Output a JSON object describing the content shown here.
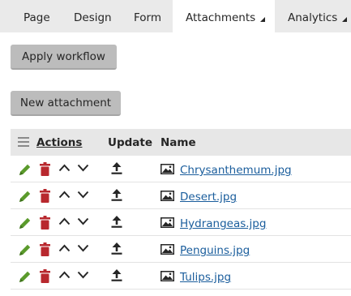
{
  "tabs": [
    {
      "label": "Page",
      "active": false,
      "dropdown": false
    },
    {
      "label": "Design",
      "active": false,
      "dropdown": false
    },
    {
      "label": "Form",
      "active": false,
      "dropdown": false
    },
    {
      "label": "Attachments",
      "active": true,
      "dropdown": true
    },
    {
      "label": "Analytics",
      "active": false,
      "dropdown": true
    }
  ],
  "buttons": {
    "apply_workflow": "Apply workflow",
    "new_attachment": "New attachment"
  },
  "grid": {
    "columns": {
      "actions": "Actions",
      "update": "Update",
      "name": "Name"
    },
    "rows": [
      {
        "name": "Chrysanthemum.jpg"
      },
      {
        "name": "Desert.jpg"
      },
      {
        "name": "Hydrangeas.jpg"
      },
      {
        "name": "Penguins.jpg"
      },
      {
        "name": "Tulips.jpg"
      }
    ]
  },
  "colors": {
    "edit_icon": "#5a9a2b",
    "delete_icon": "#b8282e",
    "link": "#1a5d9c",
    "tab_bar": "#eaeaea",
    "button": "#bcbcbc"
  },
  "icons": {
    "edit": "pencil-icon",
    "delete": "trash-icon",
    "move_up": "chevron-up-icon",
    "move_down": "chevron-down-icon",
    "update": "upload-icon",
    "file": "image-icon",
    "column_menu": "menu-icon"
  }
}
